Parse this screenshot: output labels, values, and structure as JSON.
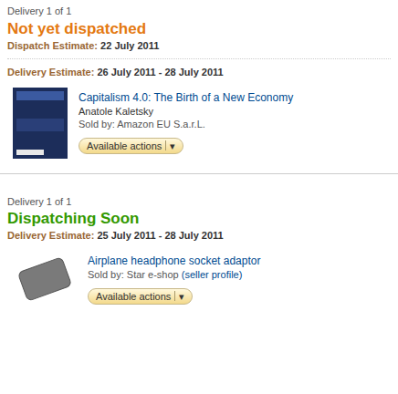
{
  "shipments": [
    {
      "delivery_label": "Delivery 1 of 1",
      "status": "Not yet dispatched",
      "color": "#e47911",
      "dispatch_estimate": {
        "label": "Dispatch Estimate:",
        "value": "22 July 2011"
      },
      "delivery_estimate": {
        "label": "Delivery Estimate:",
        "value": "26 July 2011 - 28 July 2011"
      },
      "items": [
        {
          "kind": "book",
          "title": "Capitalism 4.0: The Birth of a New Economy",
          "author": "Anatole Kaletsky",
          "seller_prefix": "Sold by:",
          "seller": "Amazon EU S.a.r.L.",
          "seller_link": "",
          "button": "Available actions",
          "caret": "▾"
        }
      ]
    },
    {
      "delivery_label": "Delivery 1 of 1",
      "status": "Dispatching Soon",
      "color": "#339900",
      "dispatch_estimate": null,
      "delivery_estimate": {
        "label": "Delivery Estimate:",
        "value": "25 July 2011 - 28 July 2011"
      },
      "items": [
        {
          "kind": "adaptor",
          "title": "Airplane headphone socket adaptor",
          "author": "",
          "seller_prefix": "Sold by:",
          "seller": "Star e-shop",
          "seller_link": "(seller profile)",
          "button": "Available actions",
          "caret": "▾"
        }
      ]
    }
  ]
}
